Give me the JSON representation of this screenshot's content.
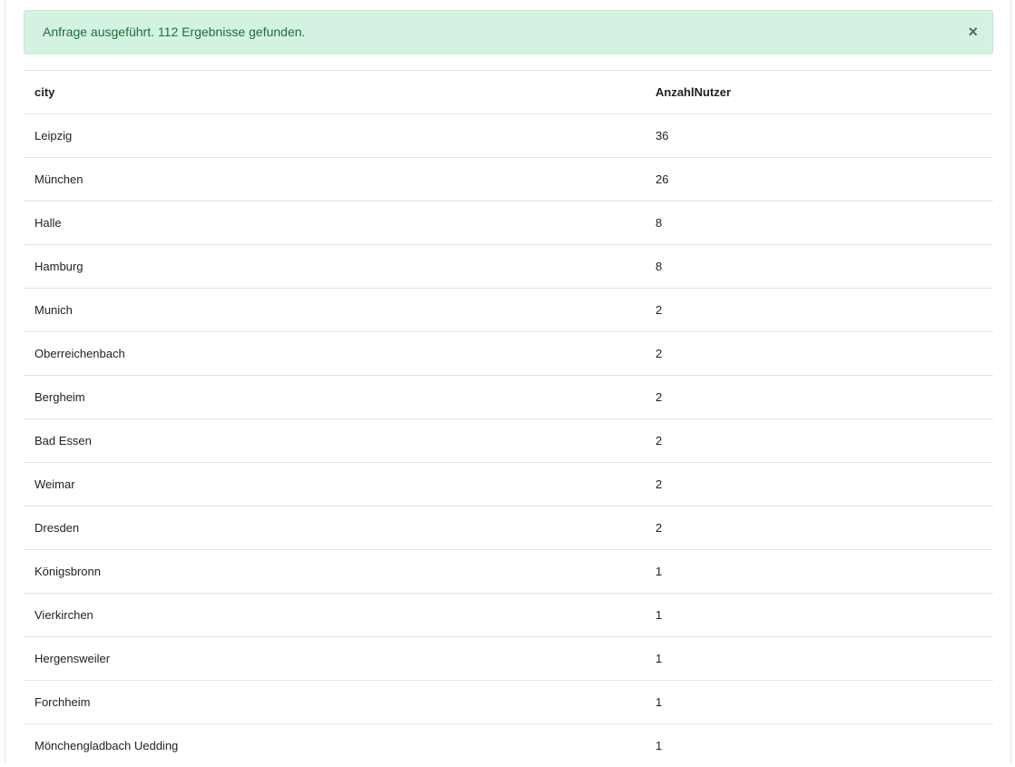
{
  "alert": {
    "message": "Anfrage ausgeführt. 112 Ergebnisse gefunden.",
    "close_label": "×"
  },
  "table": {
    "headers": [
      "city",
      "AnzahlNutzer"
    ],
    "rows": [
      [
        "Leipzig",
        "36"
      ],
      [
        "München",
        "26"
      ],
      [
        "Halle",
        "8"
      ],
      [
        "Hamburg",
        "8"
      ],
      [
        "Munich",
        "2"
      ],
      [
        "Oberreichenbach",
        "2"
      ],
      [
        "Bergheim",
        "2"
      ],
      [
        "Bad Essen",
        "2"
      ],
      [
        "Weimar",
        "2"
      ],
      [
        "Dresden",
        "2"
      ],
      [
        "Königsbronn",
        "1"
      ],
      [
        "Vierkirchen",
        "1"
      ],
      [
        "Hergensweiler",
        "1"
      ],
      [
        "Forchheim",
        "1"
      ],
      [
        "Mönchengladbach Uedding",
        "1"
      ]
    ]
  }
}
